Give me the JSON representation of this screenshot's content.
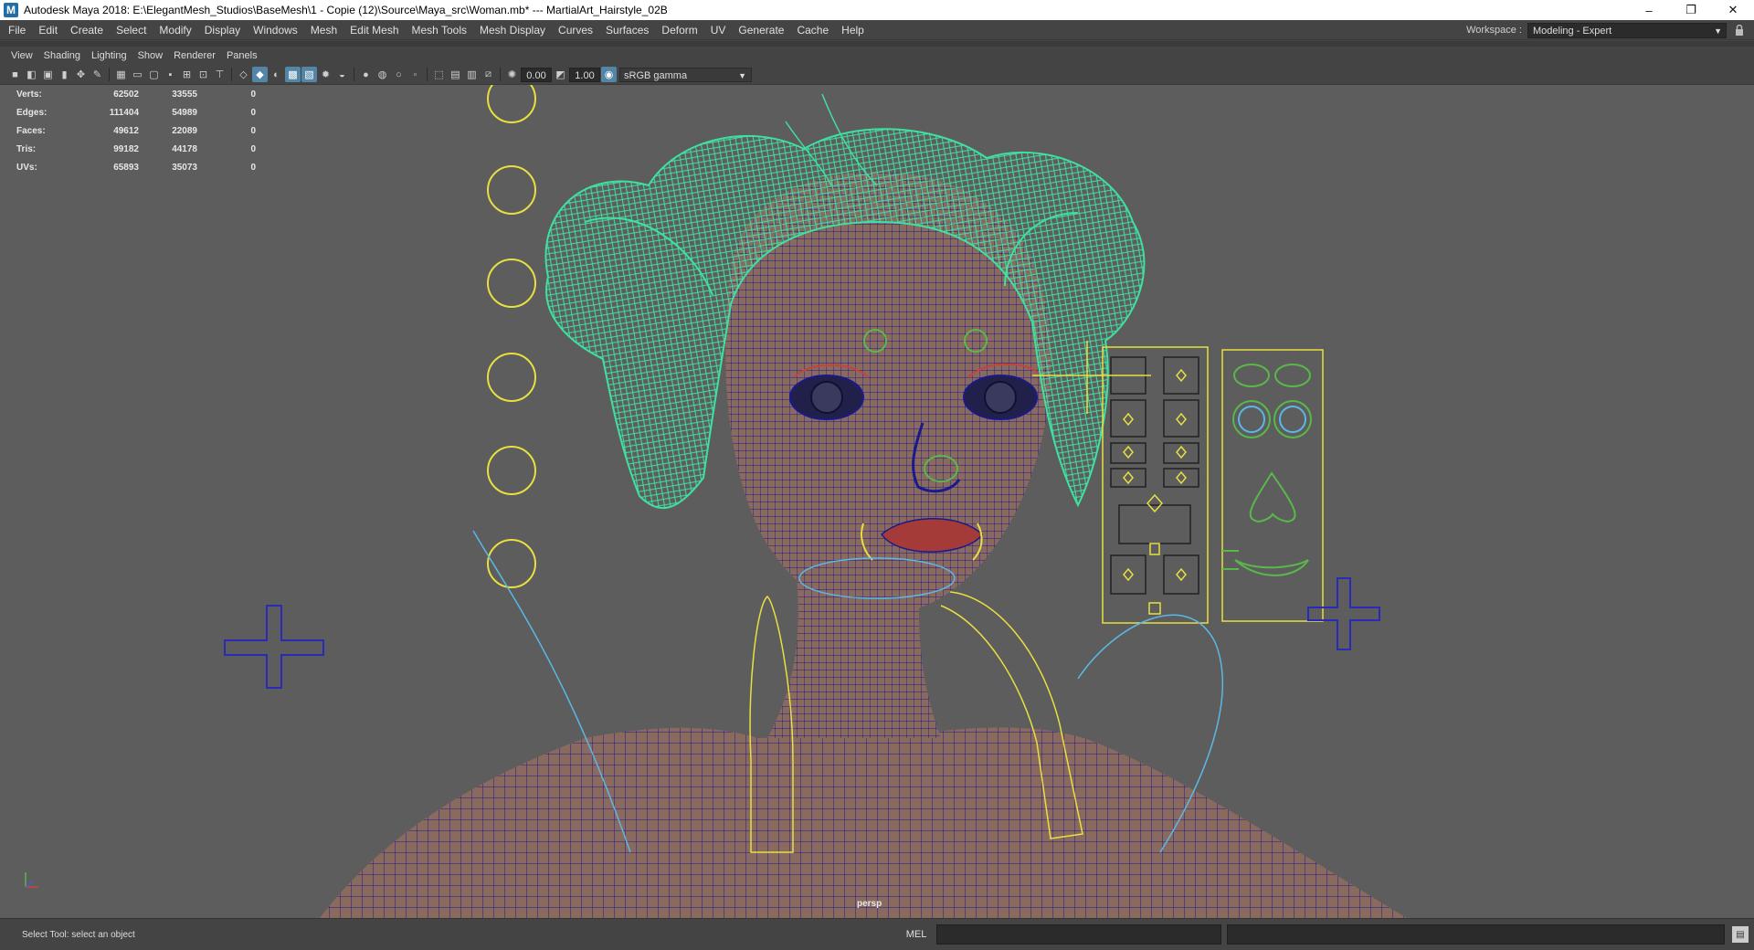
{
  "window": {
    "app_icon": "M",
    "title": "Autodesk Maya 2018: E:\\ElegantMesh_Studios\\BaseMesh\\1 - Copie (12)\\Source\\Maya_src\\Woman.mb*   ---   MartialArt_Hairstyle_02B",
    "minimize": "–",
    "restore": "❐",
    "close": "✕"
  },
  "menu": [
    "File",
    "Edit",
    "Create",
    "Select",
    "Modify",
    "Display",
    "Windows",
    "Mesh",
    "Edit Mesh",
    "Mesh Tools",
    "Mesh Display",
    "Curves",
    "Surfaces",
    "Deform",
    "UV",
    "Generate",
    "Cache",
    "Help"
  ],
  "workspace": {
    "label": "Workspace :",
    "value": "Modeling - Expert",
    "lock_icon": "lock-icon"
  },
  "panel_menu": [
    "View",
    "Shading",
    "Lighting",
    "Show",
    "Renderer",
    "Panels"
  ],
  "panel_toolbar": {
    "exposure": "0.00",
    "gamma": "1.00",
    "color_space": "sRGB gamma"
  },
  "hud": {
    "rows": [
      {
        "label": "Verts:",
        "v1": "62502",
        "v2": "33555",
        "v3": "0"
      },
      {
        "label": "Edges:",
        "v1": "111404",
        "v2": "54989",
        "v3": "0"
      },
      {
        "label": "Faces:",
        "v1": "49612",
        "v2": "22089",
        "v3": "0"
      },
      {
        "label": "Tris:",
        "v1": "99182",
        "v2": "44178",
        "v3": "0"
      },
      {
        "label": "UVs:",
        "v1": "65893",
        "v2": "35073",
        "v3": "0"
      }
    ]
  },
  "viewport": {
    "camera": "persp"
  },
  "status": {
    "help_line": "Select Tool: select an object",
    "script_type": "MEL"
  },
  "colors": {
    "viewport_bg": "#5d5d5d",
    "skin": "#8a6a5e",
    "wire": "#1a1a8c",
    "hair": "#3fe0a0",
    "control_yellow": "#e8e040",
    "control_blue": "#2a2ab8",
    "control_cyan": "#5ab8e6"
  }
}
